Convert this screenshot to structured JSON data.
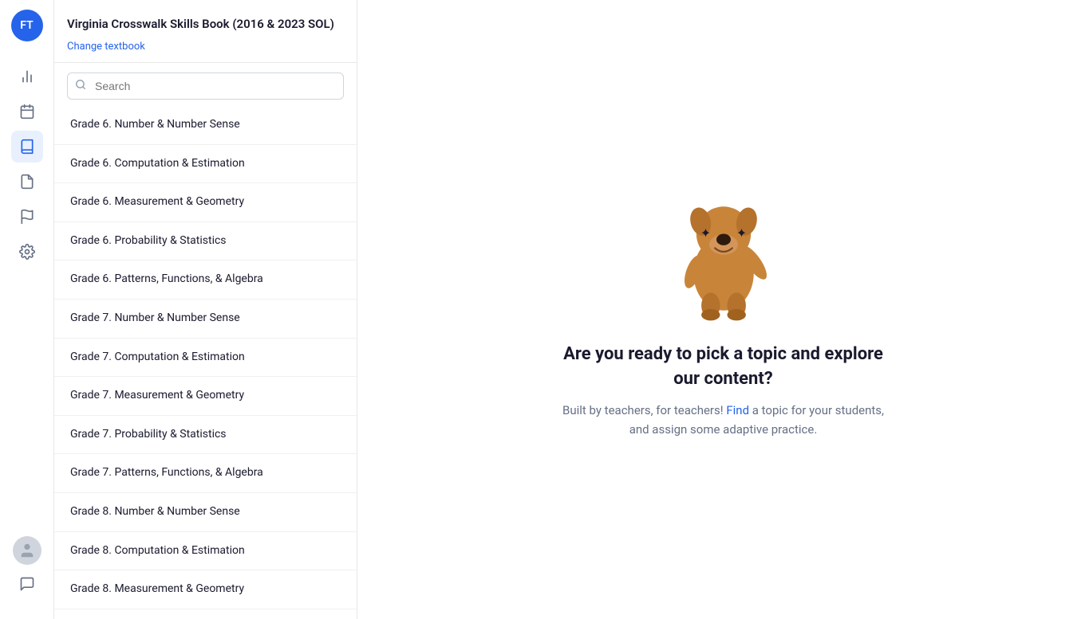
{
  "nav": {
    "logo_initials": "FT",
    "logo_bg": "#2563eb",
    "icons": [
      {
        "name": "analytics-icon",
        "glyph": "📊",
        "active": false
      },
      {
        "name": "calendar-icon",
        "glyph": "📅",
        "active": false
      },
      {
        "name": "books-icon",
        "glyph": "📚",
        "active": true
      },
      {
        "name": "document-icon",
        "glyph": "📄",
        "active": false
      },
      {
        "name": "flag-icon",
        "glyph": "🚩",
        "active": false
      },
      {
        "name": "settings-icon",
        "glyph": "⚙️",
        "active": false
      }
    ]
  },
  "sidebar": {
    "title": "Virginia Crosswalk Skills Book (2016 & 2023 SOL)",
    "change_textbook_label": "Change textbook",
    "search_placeholder": "Search",
    "topics": [
      {
        "label": "Grade 6. Number & Number Sense"
      },
      {
        "label": "Grade 6. Computation & Estimation"
      },
      {
        "label": "Grade 6. Measurement & Geometry"
      },
      {
        "label": "Grade 6. Probability & Statistics"
      },
      {
        "label": "Grade 6. Patterns, Functions, & Algebra"
      },
      {
        "label": "Grade 7. Number & Number Sense"
      },
      {
        "label": "Grade 7. Computation & Estimation"
      },
      {
        "label": "Grade 7. Measurement & Geometry"
      },
      {
        "label": "Grade 7. Probability & Statistics"
      },
      {
        "label": "Grade 7. Patterns, Functions, & Algebra"
      },
      {
        "label": "Grade 8. Number & Number Sense"
      },
      {
        "label": "Grade 8. Computation & Estimation"
      },
      {
        "label": "Grade 8. Measurement & Geometry"
      }
    ]
  },
  "main": {
    "heading": "Are you ready to pick a topic and explore our content?",
    "subtext_before_link": "Built by teachers, for teachers! ",
    "subtext_link": "Find",
    "subtext_after_link": " a topic for your students, and assign some adaptive practice."
  }
}
